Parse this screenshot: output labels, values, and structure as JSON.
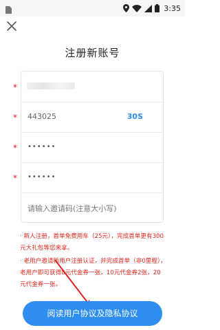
{
  "status": {
    "time": "3:35"
  },
  "header": {
    "title": "注册新账号"
  },
  "form": {
    "phone_value": "",
    "code_value": "443025",
    "code_timer": "30S",
    "password_mask": "••••••",
    "confirm_mask": "••••••",
    "invite_placeholder": "请输入邀请码(注意大小写)"
  },
  "notices": {
    "first": "· 新人注册，首单免费用车（25元），完成首单更有300元大礼包等您来拿。",
    "second": "· 老用户邀请新用户注册认证，并完成首单（非0里程），老用户即可获得8元代金券一张，10元代金券2张，20元代金券一张。"
  },
  "footer": {
    "agree_label": "阅读用户协议及隐私协议"
  },
  "colors": {
    "accent": "#2d8df0",
    "warning": "#e0281f"
  }
}
